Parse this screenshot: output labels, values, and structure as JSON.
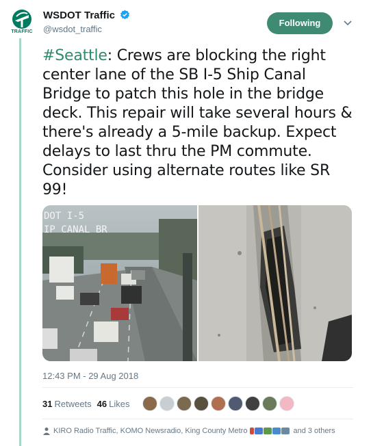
{
  "account": {
    "display_name": "WSDOT Traffic",
    "handle": "@wsdot_traffic",
    "avatar_text": "TRAFFIC",
    "brand_color": "#007b5f",
    "verified": true
  },
  "follow_button": {
    "label": "Following",
    "color": "#3e8a73"
  },
  "tweet": {
    "hashtag": "#Seattle",
    "body": ": Crews are blocking the right center lane of the SB I-5 Ship Canal Bridge to patch this hole in the bridge deck. This repair will take several hours & there's already a 5-mile backup. Expect delays to last thru the PM commute. Consider using alternate routes like SR 99!",
    "hashtag_color": "#2e8b6c"
  },
  "media": {
    "camera_overlay_line1": "DOT  I-5",
    "camera_overlay_line2": "IP CANAL BR"
  },
  "timestamp": "12:43 PM - 29 Aug 2018",
  "stats": {
    "retweets_count": "31",
    "retweets_label": "Retweets",
    "likes_count": "46",
    "likes_label": "Likes"
  },
  "likers": [
    "#8a6a4a",
    "#c9ced3",
    "#7a6a50",
    "#5a5040",
    "#b07050",
    "#505a70",
    "#404040",
    "#6a7a5a",
    "#f2b8c4"
  ],
  "context": {
    "text_before": "KIRO Radio Traffic, KOMO Newsradio, King County Metro",
    "text_after": "and 3 others"
  }
}
